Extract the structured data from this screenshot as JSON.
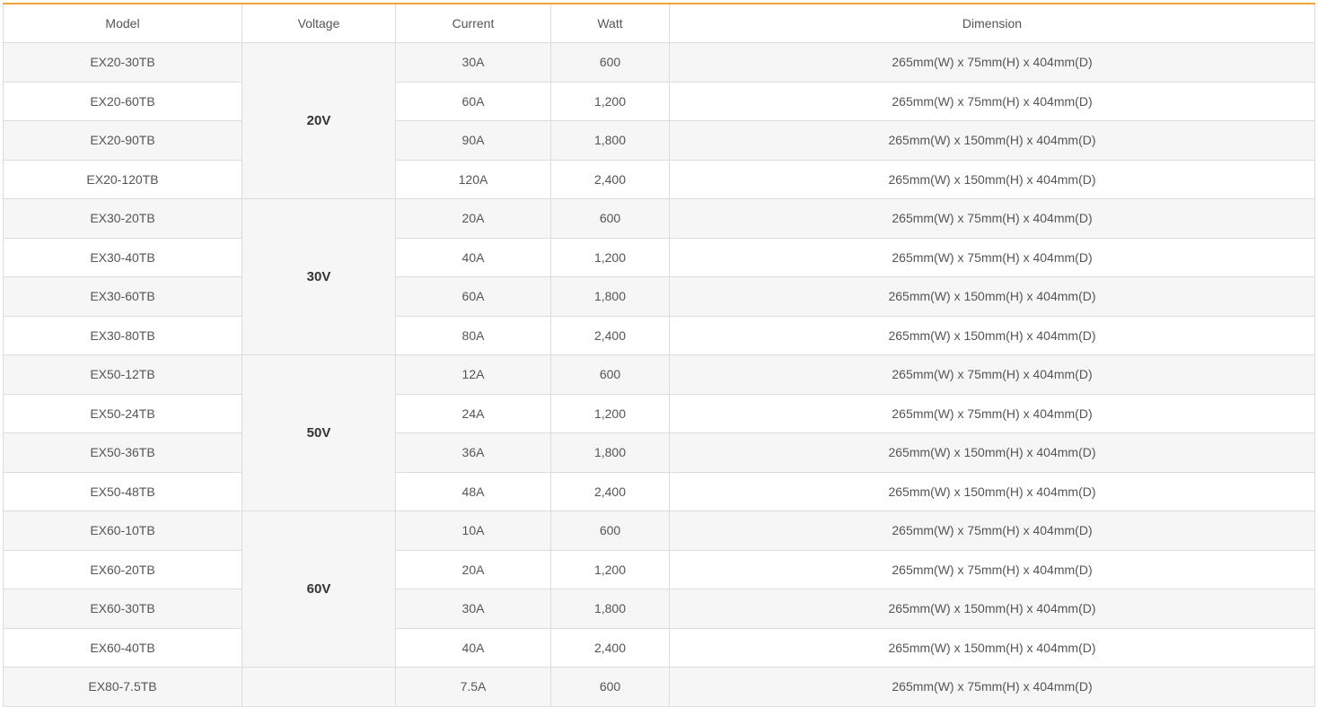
{
  "table": {
    "headers": [
      "Model",
      "Voltage",
      "Current",
      "Watt",
      "Dimension"
    ],
    "groups": [
      {
        "voltage": "20V",
        "rows": [
          {
            "model": "EX20-30TB",
            "current": "30A",
            "watt": "600",
            "dimension": "265mm(W) x 75mm(H) x 404mm(D)"
          },
          {
            "model": "EX20-60TB",
            "current": "60A",
            "watt": "1,200",
            "dimension": "265mm(W) x 75mm(H) x 404mm(D)"
          },
          {
            "model": "EX20-90TB",
            "current": "90A",
            "watt": "1,800",
            "dimension": "265mm(W) x 150mm(H) x 404mm(D)"
          },
          {
            "model": "EX20-120TB",
            "current": "120A",
            "watt": "2,400",
            "dimension": "265mm(W) x 150mm(H) x 404mm(D)"
          }
        ]
      },
      {
        "voltage": "30V",
        "rows": [
          {
            "model": "EX30-20TB",
            "current": "20A",
            "watt": "600",
            "dimension": "265mm(W) x 75mm(H) x 404mm(D)"
          },
          {
            "model": "EX30-40TB",
            "current": "40A",
            "watt": "1,200",
            "dimension": "265mm(W) x 75mm(H) x 404mm(D)"
          },
          {
            "model": "EX30-60TB",
            "current": "60A",
            "watt": "1,800",
            "dimension": "265mm(W) x 150mm(H) x 404mm(D)"
          },
          {
            "model": "EX30-80TB",
            "current": "80A",
            "watt": "2,400",
            "dimension": "265mm(W) x 150mm(H) x 404mm(D)"
          }
        ]
      },
      {
        "voltage": "50V",
        "rows": [
          {
            "model": "EX50-12TB",
            "current": "12A",
            "watt": "600",
            "dimension": "265mm(W) x 75mm(H) x 404mm(D)"
          },
          {
            "model": "EX50-24TB",
            "current": "24A",
            "watt": "1,200",
            "dimension": "265mm(W) x 75mm(H) x 404mm(D)"
          },
          {
            "model": "EX50-36TB",
            "current": "36A",
            "watt": "1,800",
            "dimension": "265mm(W) x 150mm(H) x 404mm(D)"
          },
          {
            "model": "EX50-48TB",
            "current": "48A",
            "watt": "2,400",
            "dimension": "265mm(W) x 150mm(H) x 404mm(D)"
          }
        ]
      },
      {
        "voltage": "60V",
        "rows": [
          {
            "model": "EX60-10TB",
            "current": "10A",
            "watt": "600",
            "dimension": "265mm(W) x 75mm(H) x 404mm(D)"
          },
          {
            "model": "EX60-20TB",
            "current": "20A",
            "watt": "1,200",
            "dimension": "265mm(W) x 75mm(H) x 404mm(D)"
          },
          {
            "model": "EX60-30TB",
            "current": "30A",
            "watt": "1,800",
            "dimension": "265mm(W) x 150mm(H) x 404mm(D)"
          },
          {
            "model": "EX60-40TB",
            "current": "40A",
            "watt": "2,400",
            "dimension": "265mm(W) x 150mm(H) x 404mm(D)"
          }
        ]
      },
      {
        "voltage": "",
        "rows": [
          {
            "model": "EX80-7.5TB",
            "current": "7.5A",
            "watt": "600",
            "dimension": "265mm(W) x 75mm(H) x 404mm(D)"
          }
        ]
      }
    ],
    "accent_color": "#f0a23a",
    "stripe_color": "#f6f6f6",
    "border_color": "#dcdcdc"
  }
}
